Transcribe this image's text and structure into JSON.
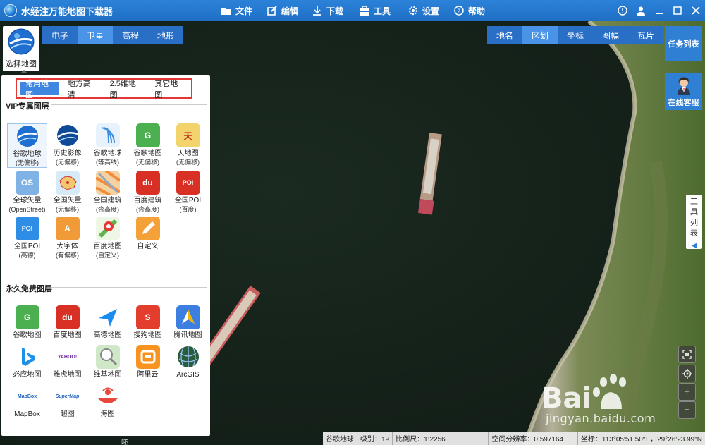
{
  "app": {
    "title": "水经注万能地图下载器"
  },
  "menu": [
    {
      "label": "文件",
      "icon": "folder-icon"
    },
    {
      "label": "编辑",
      "icon": "edit-icon"
    },
    {
      "label": "下载",
      "icon": "download-icon"
    },
    {
      "label": "工具",
      "icon": "toolbox-icon"
    },
    {
      "label": "设置",
      "icon": "gear-icon"
    },
    {
      "label": "帮助",
      "icon": "help-icon"
    }
  ],
  "map_type_tabs": [
    "电子",
    "卫星",
    "高程",
    "地形"
  ],
  "map_type_active": "卫星",
  "layer_tabs": [
    "地名",
    "区划",
    "坐标",
    "图幅",
    "瓦片"
  ],
  "layer_active": "区划",
  "right_buttons": {
    "task_list": "任务列表",
    "online_support": "在线客服",
    "tools_list": [
      "工",
      "具",
      "列",
      "表"
    ]
  },
  "zoom_controls": [
    "fullscreen-icon",
    "locate-icon",
    "zoom-in-icon",
    "zoom-out-icon"
  ],
  "zoom_labels": {
    "zoom_in": "+",
    "zoom_out": "−"
  },
  "select_map": {
    "label": "选择地图"
  },
  "panel": {
    "tabs": [
      "常用地图",
      "地方高清",
      "2.5维地图",
      "其它地图"
    ],
    "active_tab": "常用地图",
    "vip_title": "VIP专属图层",
    "free_title": "永久免费图层",
    "vip_items": [
      {
        "l1": "谷歌地球",
        "l2": "(无偏移)",
        "icon": "google-earth-icon",
        "color": "#1f6fd1",
        "glyph": ""
      },
      {
        "l1": "历史影像",
        "l2": "(无偏移)",
        "icon": "history-imagery-icon",
        "color": "#0e4a97",
        "glyph": ""
      },
      {
        "l1": "谷歌地球",
        "l2": "(等高线)",
        "icon": "contour-icon",
        "color": "#3b8fe2",
        "glyph": "≋"
      },
      {
        "l1": "谷歌地图",
        "l2": "(无偏移)",
        "icon": "google-maps-icon",
        "color": "#4caf50",
        "glyph": "G"
      },
      {
        "l1": "天地图",
        "l2": "(无偏移)",
        "icon": "tianditu-icon",
        "color": "#f3d36b",
        "glyph": "天"
      },
      {
        "l1": "全球矢量",
        "l2": "(OpenStreet)",
        "icon": "openstreet-icon",
        "color": "#7fb3e6",
        "glyph": "OS"
      },
      {
        "l1": "全国矢量",
        "l2": "(无偏移)",
        "icon": "china-vector-icon",
        "color": "#9ccbe8",
        "glyph": ""
      },
      {
        "l1": "全国建筑",
        "l2": "(含高度)",
        "icon": "building-icon",
        "color": "#f08c3a",
        "glyph": ""
      },
      {
        "l1": "百度建筑",
        "l2": "(含高度)",
        "icon": "baidu-building-icon",
        "color": "#d93025",
        "glyph": "du"
      },
      {
        "l1": "全国POI",
        "l2": "(百度)",
        "icon": "poi-baidu-icon",
        "color": "#d93025",
        "glyph": "POI"
      },
      {
        "l1": "全国POI",
        "l2": "(高德)",
        "icon": "poi-gaode-icon",
        "color": "#2e8ee6",
        "glyph": "POI"
      },
      {
        "l1": "大字体",
        "l2": "(有偏移)",
        "icon": "large-font-icon",
        "color": "#f19a38",
        "glyph": "A"
      },
      {
        "l1": "百度地图",
        "l2": "(自定义)",
        "icon": "baidu-custom-icon",
        "color": "#5fb34d",
        "glyph": ""
      },
      {
        "l1": "自定义",
        "l2": "",
        "icon": "custom-pencil-icon",
        "color": "#f4a13a",
        "glyph": "✎"
      }
    ],
    "free_items": [
      {
        "l1": "谷歌地图",
        "icon": "google-maps-free-icon",
        "color": "#4caf50",
        "glyph": "G"
      },
      {
        "l1": "百度地图",
        "icon": "baidu-maps-icon",
        "color": "#d93025",
        "glyph": "du"
      },
      {
        "l1": "高德地图",
        "icon": "gaode-maps-icon",
        "color": "#ffffff",
        "glyph": ""
      },
      {
        "l1": "搜狗地图",
        "icon": "sogou-maps-icon",
        "color": "#e33d2e",
        "glyph": "S"
      },
      {
        "l1": "腾讯地图",
        "icon": "tencent-maps-icon",
        "color": "#3c7fe0",
        "glyph": ""
      },
      {
        "l1": "必应地图",
        "icon": "bing-maps-icon",
        "color": "#ffffff",
        "glyph": "b"
      },
      {
        "l1": "雅虎地图",
        "icon": "yahoo-maps-icon",
        "color": "#ffffff",
        "glyph": "YAHOO!"
      },
      {
        "l1": "维基地图",
        "icon": "wiki-maps-icon",
        "color": "#cfe9c8",
        "glyph": ""
      },
      {
        "l1": "阿里云",
        "icon": "aliyun-icon",
        "color": "#f7931e",
        "glyph": ""
      },
      {
        "l1": "ArcGIS",
        "icon": "arcgis-icon",
        "color": "#2a5d3c",
        "glyph": ""
      },
      {
        "l1": "MapBox",
        "icon": "mapbox-icon",
        "color": "#ffffff",
        "glyph": "MapBox"
      },
      {
        "l1": "超图",
        "icon": "supermap-icon",
        "color": "#ffffff",
        "glyph": "SuperMap"
      },
      {
        "l1": "海图",
        "icon": "sea-chart-icon",
        "color": "#ffffff",
        "glyph": ""
      }
    ]
  },
  "status": {
    "source": "谷歌地球",
    "level": "级别：19",
    "scale": "比例尺：1:2256",
    "resolution": "空间分辨率：0.597164",
    "coords": "坐标：113°05′51.50″E，29°26′23.99″N"
  },
  "watermark": {
    "url": "jingyan.baidu.com"
  },
  "bottom_mark": "呸"
}
